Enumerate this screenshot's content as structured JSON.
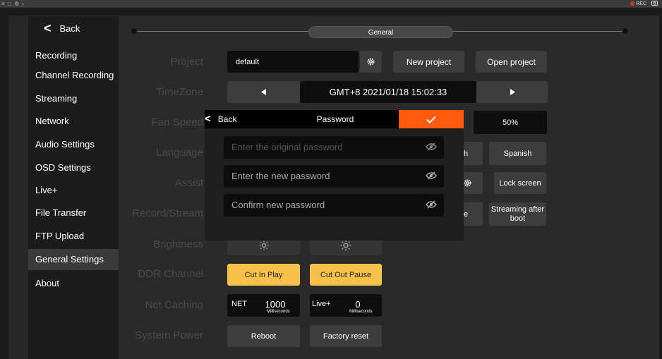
{
  "topbar": {
    "left_icons": "≡ □ ⚙ ‹",
    "rec": "REC"
  },
  "sidebar": {
    "back_label": "Back",
    "items": [
      {
        "label": "Recording"
      },
      {
        "label": "Channel Recording"
      },
      {
        "label": "Streaming"
      },
      {
        "label": "Network"
      },
      {
        "label": "Audio Settings"
      },
      {
        "label": "OSD Settings"
      },
      {
        "label": "Live+"
      },
      {
        "label": "File Transfer"
      },
      {
        "label": "FTP Upload"
      },
      {
        "label": "General Settings",
        "active": true
      },
      {
        "label": "About"
      }
    ]
  },
  "header": {
    "tab": "General"
  },
  "labels": {
    "project": "Project",
    "timezone": "TimeZone",
    "fan_speed": "Fan Speed",
    "language": "Language",
    "assist": "Assist",
    "record_stream": "Record/Stream",
    "brightness": "Brightness",
    "ddr_channel": "DDR Channel",
    "net_caching": "Net Caching",
    "system_power": "System Power"
  },
  "project": {
    "value": "default",
    "new_label": "New project",
    "open_label": "Open project"
  },
  "timezone": {
    "value": "GMT+8 2021/01/18 15:02:33"
  },
  "fan": {
    "value": "50%"
  },
  "language": {
    "partial": "h",
    "spanish": "Spanish"
  },
  "assist": {
    "lock_label": "Lock screen"
  },
  "record_stream": {
    "partial": "e",
    "streaming_label": "Streaming after boot"
  },
  "ddr": {
    "cut_in": "Cut In Play",
    "cut_out": "Cut Out Pause"
  },
  "net_caching": {
    "net_key": "NET",
    "net_value": "1000",
    "net_unit": "Milliseconds",
    "live_key": "Live+",
    "live_value": "0",
    "live_unit": "Milliseconds"
  },
  "power": {
    "reboot": "Reboot",
    "factory": "Factory reset"
  },
  "dialog": {
    "back_label": "Back",
    "title": "Password",
    "fields": [
      {
        "placeholder": "Enter the original password"
      },
      {
        "placeholder": "Enter the new password"
      },
      {
        "placeholder": "Confirm new password"
      }
    ]
  },
  "colors": {
    "accent": "#ff5a10",
    "yellow": "#f6c14a"
  }
}
